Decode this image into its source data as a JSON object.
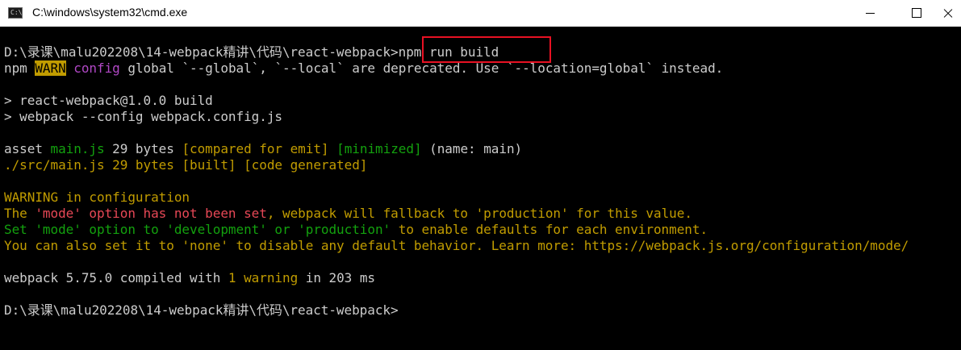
{
  "window": {
    "title": "C:\\windows\\system32\\cmd.exe",
    "icon_text": "C:\\"
  },
  "colors": {
    "accent_highlight": "#e81123",
    "warn_badge": "#c19c00",
    "keyword_magenta": "#b148c6",
    "success_green": "#13a10e",
    "error_red": "#e74856"
  },
  "console": {
    "line1": {
      "prompt": "D:\\录课\\malu202208\\14-webpack精讲\\代码\\react-webpack>",
      "command": "npm run build"
    },
    "line2": {
      "npm": "npm ",
      "warn": "WARN",
      "config": " config",
      "rest": " global `--global`, `--local` are deprecated. Use `--location=global` instead."
    },
    "line3": "> react-webpack@1.0.0 build",
    "line4": "> webpack --config webpack.config.js",
    "line5": {
      "asset": "asset ",
      "filename": "main.js",
      "size": " 29 bytes ",
      "compared": "[compared for emit]",
      "sp": " ",
      "minimized": "[minimized]",
      "name": " (name: main)"
    },
    "line6": "./src/main.js 29 bytes [built] [code generated]",
    "line7": {
      "warning": "WARNING",
      "rest": " in configuration"
    },
    "line8": {
      "the": "The ",
      "mode_option_not_set": "'mode' option has not been set",
      "rest": ", webpack will fallback to 'production' for this value."
    },
    "line9": {
      "set_mode": "Set 'mode' option to 'development' or 'production'",
      "rest": " to enable defaults for each environment."
    },
    "line10": "You can also set it to 'none' to disable any default behavior. Learn more: https://webpack.js.org/configuration/mode/",
    "line11": {
      "prefix": "webpack 5.75.0 compiled with ",
      "one": "1",
      "sp": " ",
      "warning": "warning",
      "rest": " in 203 ms"
    },
    "line12": "D:\\录课\\malu202208\\14-webpack精讲\\代码\\react-webpack>"
  }
}
